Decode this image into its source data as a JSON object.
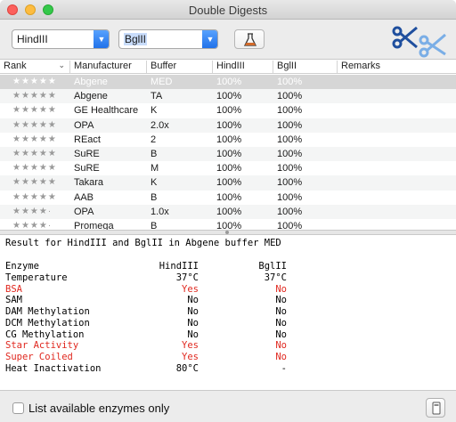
{
  "window": {
    "title": "Double Digests"
  },
  "toolbar": {
    "enzyme1": "HindIII",
    "enzyme2": "BglII",
    "flask_icon": "flask-icon",
    "scissors_icon": "scissors-icon"
  },
  "table": {
    "columns": [
      "Rank",
      "Manufacturer",
      "Buffer",
      "HindIII",
      "BglII",
      "Remarks"
    ],
    "rows": [
      {
        "rank": "★★★★★",
        "manufacturer": "Abgene",
        "buffer": "MED",
        "e1": "100%",
        "e2": "100%",
        "remarks": ""
      },
      {
        "rank": "★★★★★",
        "manufacturer": "Abgene",
        "buffer": "TA",
        "e1": "100%",
        "e2": "100%",
        "remarks": ""
      },
      {
        "rank": "★★★★★",
        "manufacturer": "GE Healthcare",
        "buffer": "K",
        "e1": "100%",
        "e2": "100%",
        "remarks": ""
      },
      {
        "rank": "★★★★★",
        "manufacturer": "OPA",
        "buffer": "2.0x",
        "e1": "100%",
        "e2": "100%",
        "remarks": ""
      },
      {
        "rank": "★★★★★",
        "manufacturer": "REact",
        "buffer": "2",
        "e1": "100%",
        "e2": "100%",
        "remarks": ""
      },
      {
        "rank": "★★★★★",
        "manufacturer": "SuRE",
        "buffer": "B",
        "e1": "100%",
        "e2": "100%",
        "remarks": ""
      },
      {
        "rank": "★★★★★",
        "manufacturer": "SuRE",
        "buffer": "M",
        "e1": "100%",
        "e2": "100%",
        "remarks": ""
      },
      {
        "rank": "★★★★★",
        "manufacturer": "Takara",
        "buffer": "K",
        "e1": "100%",
        "e2": "100%",
        "remarks": ""
      },
      {
        "rank": "★★★★★",
        "manufacturer": "AAB",
        "buffer": "B",
        "e1": "100%",
        "e2": "100%",
        "remarks": ""
      },
      {
        "rank": "★★★★·",
        "manufacturer": "OPA",
        "buffer": "1.0x",
        "e1": "100%",
        "e2": "100%",
        "remarks": ""
      },
      {
        "rank": "★★★★·",
        "manufacturer": "Promega",
        "buffer": "B",
        "e1": "100%",
        "e2": "100%",
        "remarks": ""
      }
    ]
  },
  "result": {
    "heading": "Result for HindIII and BglII in Abgene buffer MED",
    "header": {
      "label": "Enzyme",
      "e1": "HindIII",
      "e2": "BglII"
    },
    "lines": [
      {
        "label": "Temperature",
        "e1": "37°C",
        "e2": "37°C",
        "red": false
      },
      {
        "label": "BSA",
        "e1": "Yes",
        "e2": "No",
        "red": true
      },
      {
        "label": "SAM",
        "e1": "No",
        "e2": "No",
        "red": false
      },
      {
        "label": "DAM Methylation",
        "e1": "No",
        "e2": "No",
        "red": false
      },
      {
        "label": "DCM Methylation",
        "e1": "No",
        "e2": "No",
        "red": false
      },
      {
        "label": "CG Methylation",
        "e1": "No",
        "e2": "No",
        "red": false
      },
      {
        "label": "Star Activity",
        "e1": "Yes",
        "e2": "No",
        "red": true
      },
      {
        "label": "Super Coiled",
        "e1": "Yes",
        "e2": "No",
        "red": true
      },
      {
        "label": "Heat Inactivation",
        "e1": "80°C",
        "e2": "-",
        "red": false
      }
    ]
  },
  "footer": {
    "checkbox_label": "List available enzymes only",
    "checked": false
  },
  "colors": {
    "highlight": "#e0281f",
    "selection": "#d6d6d6",
    "accent": "#1e6fe8"
  }
}
